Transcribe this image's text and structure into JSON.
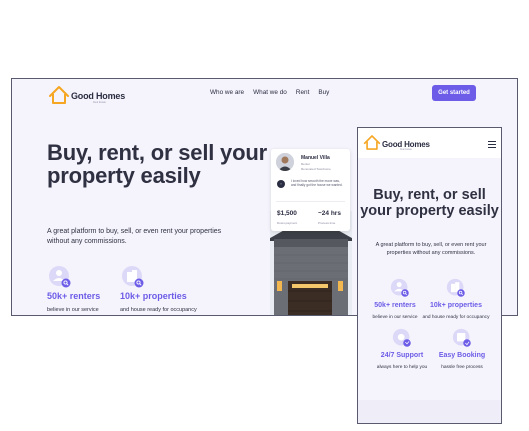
{
  "brand": {
    "name": "Good Homes",
    "tagline": "Real Estate",
    "accent_color": "#6c5ce7",
    "logo_color": "#f5a623"
  },
  "desktop": {
    "nav": {
      "items": [
        "Who we are",
        "What we do",
        "Rent",
        "Buy"
      ],
      "cta_label": "Get started"
    },
    "hero": {
      "title": "Buy, rent, or sell your property easily",
      "subtitle": "A great platform to buy, sell, or even rent your properties without any commissions."
    },
    "stats": [
      {
        "value": "50k+ renters",
        "desc": "believe in our service",
        "icon": "user-search-icon"
      },
      {
        "value": "10k+ properties",
        "desc": "and house ready for occupancy",
        "icon": "building-search-icon"
      }
    ],
    "testimonial": {
      "name": "Manuel Villa",
      "role": "Renter",
      "location": "Renovated Townhome",
      "quote": "I loved how smooth the move was, and finally got the house we wanted.",
      "price": "$1,500",
      "price_label": "Down-payment",
      "time": "~24 hrs",
      "time_label": "Process time"
    }
  },
  "mobile": {
    "hero": {
      "title": "Buy, rent, or sell your property easily",
      "subtitle": "A great platform to buy, sell, or even rent your properties without any commissions."
    },
    "stats": [
      {
        "value": "50k+ renters",
        "desc": "believe in our service",
        "icon": "user-search-icon"
      },
      {
        "value": "10k+ properties",
        "desc": "and house ready for occupancy",
        "icon": "building-search-icon"
      },
      {
        "value": "24/7 Support",
        "desc": "always here to help you",
        "icon": "support-icon"
      },
      {
        "value": "Easy Booking",
        "desc": "hassle free process",
        "icon": "calendar-icon"
      }
    ]
  }
}
